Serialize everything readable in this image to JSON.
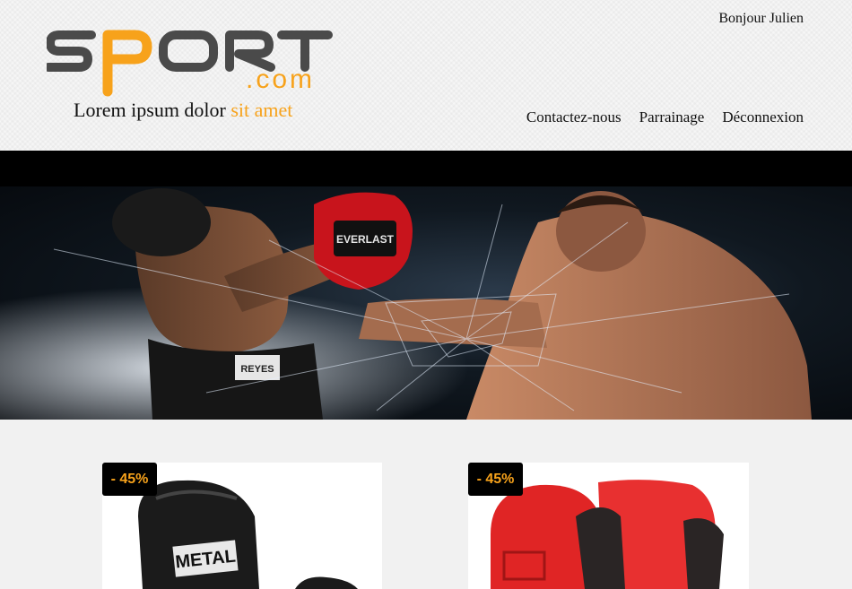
{
  "header": {
    "logo": {
      "wordmark": "SPORT",
      "suffix": ".com"
    },
    "tagline": {
      "main": "Lorem ipsum dolor",
      "highlight": "sit amet"
    },
    "greeting": "Bonjour Julien",
    "nav": [
      "Contactez-nous",
      "Parrainage",
      "Déconnexion"
    ]
  },
  "colors": {
    "accent": "#f7a21b",
    "logo_gray": "#4a4a4a",
    "bar": "#000000"
  },
  "products": [
    {
      "badge": "- 45%",
      "image": "black-boxing-gloves"
    },
    {
      "badge": "- 45%",
      "image": "red-boxing-gloves"
    }
  ]
}
